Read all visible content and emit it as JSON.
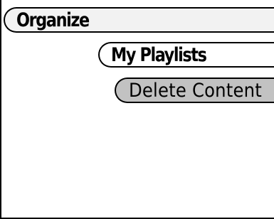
{
  "menu": {
    "items": [
      {
        "label": "Organize",
        "level": 0,
        "state": "parent"
      },
      {
        "label": "My Playlists",
        "level": 1,
        "state": "parent"
      },
      {
        "label": "Delete Content",
        "level": 2,
        "state": "selected"
      }
    ]
  },
  "colors": {
    "background": "#ffffff",
    "border": "#000000",
    "organize_fill": "#f2f2f2",
    "playlists_fill": "#ffffff",
    "selected_fill": "#c2c2c2"
  }
}
